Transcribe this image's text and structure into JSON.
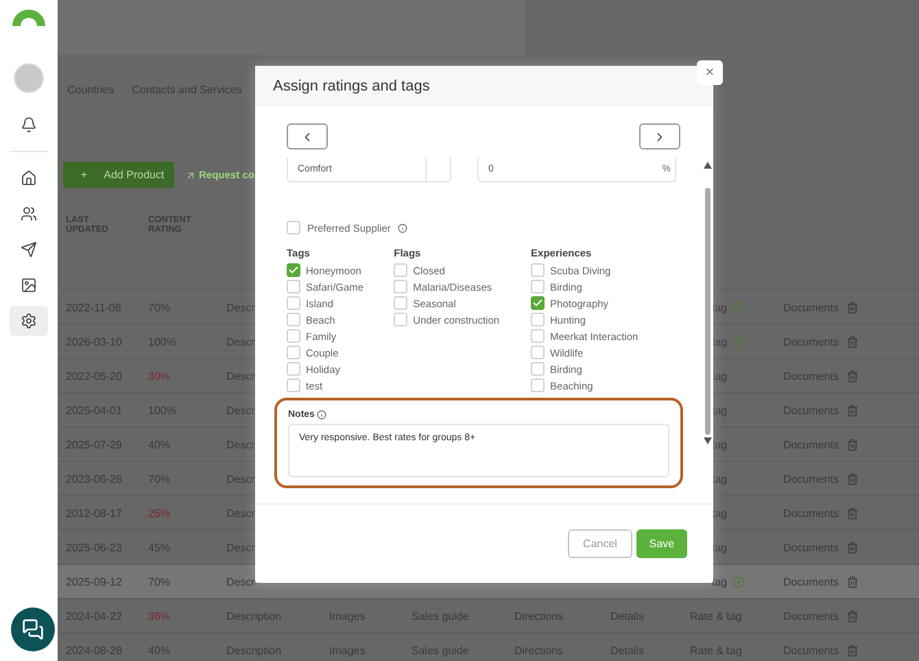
{
  "sidebar": {
    "items": [
      {
        "kind": "bell",
        "selected": false
      },
      {
        "kind": "home",
        "selected": false
      },
      {
        "kind": "users",
        "selected": false
      },
      {
        "kind": "send",
        "selected": false
      },
      {
        "kind": "image",
        "selected": false
      },
      {
        "kind": "settings",
        "selected": true
      }
    ]
  },
  "tabs": [
    {
      "label": "Countries"
    },
    {
      "label": "Contacts and Services"
    }
  ],
  "toolbar": {
    "add_button": {
      "icon": "+",
      "label": "Add Product"
    },
    "request_link": "Request co"
  },
  "table": {
    "columns": [
      "LAST UPDATED",
      "CONTENT RATING"
    ],
    "rows": [
      {
        "updated": "2022-11-08",
        "rating": "70%",
        "low": false,
        "description": "Descr",
        "rate_tag": "tag",
        "rated": true,
        "documents": "Documents",
        "highlighted": false
      },
      {
        "updated": "2026-03-10",
        "rating": "100%",
        "low": false,
        "description": "Descr",
        "rate_tag": "tag",
        "rated": true,
        "documents": "Documents",
        "highlighted": false
      },
      {
        "updated": "2022-05-20",
        "rating": "30%",
        "low": true,
        "description": "Descr",
        "rate_tag": "tag",
        "rated": false,
        "documents": "Documents",
        "highlighted": false
      },
      {
        "updated": "2025-04-01",
        "rating": "100%",
        "low": false,
        "description": "Descr",
        "rate_tag": "tag",
        "rated": false,
        "documents": "Documents",
        "highlighted": false
      },
      {
        "updated": "2025-07-29",
        "rating": "40%",
        "low": false,
        "description": "Descr",
        "rate_tag": "tag",
        "rated": false,
        "documents": "Documents",
        "highlighted": false
      },
      {
        "updated": "2023-06-26",
        "rating": "70%",
        "low": false,
        "description": "Descr",
        "rate_tag": "tag",
        "rated": false,
        "documents": "Documents",
        "highlighted": false
      },
      {
        "updated": "2012-08-17",
        "rating": "25%",
        "low": true,
        "description": "Descr",
        "rate_tag": "tag",
        "rated": false,
        "documents": "Documents",
        "highlighted": false
      },
      {
        "updated": "2025-06-23",
        "rating": "45%",
        "low": false,
        "description": "Descr",
        "rate_tag": "tag",
        "rated": false,
        "documents": "Documents",
        "highlighted": false
      },
      {
        "updated": "2025-09-12",
        "rating": "70%",
        "low": false,
        "description": "Descr",
        "rate_tag": "tag",
        "rated": true,
        "documents": "Documents",
        "highlighted": true
      },
      {
        "updated": "2024-04-22",
        "rating": "36%",
        "low": true,
        "description": "Description",
        "images": "Images",
        "sales_guide": "Sales guide",
        "directions": "Directions",
        "details": "Details",
        "rate_tag": "Rate & tag",
        "rated": false,
        "documents": "Documents",
        "highlighted": false
      },
      {
        "updated": "2024-08-28",
        "rating": "40%",
        "low": false,
        "description": "Description",
        "images": "Images",
        "sales_guide": "Sales guide",
        "directions": "Directions",
        "details": "Details",
        "rate_tag": "Rate & tag",
        "rated": false,
        "documents": "Documents",
        "highlighted": false
      }
    ]
  },
  "modal": {
    "title": "Assign ratings and tags",
    "close": "×",
    "fields": [
      {
        "value": "Comfort"
      },
      {
        "value": "0",
        "suffix": "%"
      }
    ],
    "preferred_supplier": {
      "label": "Preferred Supplier",
      "checked": false
    },
    "groups": [
      {
        "title": "Tags",
        "items": [
          {
            "label": "Honeymoon",
            "checked": true
          },
          {
            "label": "Safari/Game",
            "checked": false
          },
          {
            "label": "Island",
            "checked": false
          },
          {
            "label": "Beach",
            "checked": false
          },
          {
            "label": "Family",
            "checked": false
          },
          {
            "label": "Couple",
            "checked": false
          },
          {
            "label": "Holiday",
            "checked": false
          },
          {
            "label": "test",
            "checked": false
          }
        ]
      },
      {
        "title": "Flags",
        "items": [
          {
            "label": "Closed",
            "checked": false
          },
          {
            "label": "Malaria/Diseases",
            "checked": false
          },
          {
            "label": "Seasonal",
            "checked": false
          },
          {
            "label": "Under construction",
            "checked": false
          }
        ]
      },
      {
        "title": "Experiences",
        "items": [
          {
            "label": "Scuba Diving",
            "checked": false
          },
          {
            "label": "Birding",
            "checked": false
          },
          {
            "label": "Photography",
            "checked": true
          },
          {
            "label": "Hunting",
            "checked": false
          },
          {
            "label": "Meerkat Interaction",
            "checked": false
          },
          {
            "label": "Wildlife",
            "checked": false
          },
          {
            "label": "Birding",
            "checked": false
          },
          {
            "label": "Beaching",
            "checked": false
          }
        ]
      }
    ],
    "notes": {
      "label": "Notes",
      "value": "Very responsive. Best rates for groups 8+"
    },
    "buttons": {
      "cancel": "Cancel",
      "save": "Save"
    }
  }
}
